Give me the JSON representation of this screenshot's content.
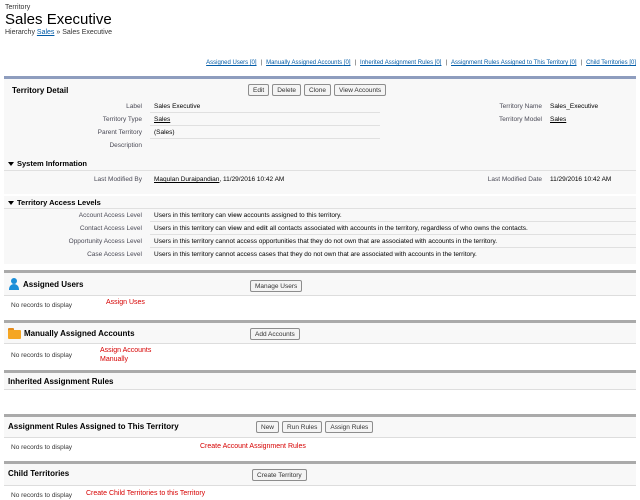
{
  "header": {
    "object_label": "Territory",
    "title": "Sales Executive",
    "hierarchy_label": "Hierarchy",
    "hierarchy_parent": "Sales",
    "hierarchy_sep": "»",
    "hierarchy_current": "Sales Executive"
  },
  "top_links": [
    {
      "label": "Assigned Users",
      "count": "[0]"
    },
    {
      "label": "Manually Assigned Accounts",
      "count": "[0]"
    },
    {
      "label": "Inherited Assignment Rules",
      "count": "[0]"
    },
    {
      "label": "Assignment Rules Assigned to This Territory",
      "count": "[0]"
    },
    {
      "label": "Child Territories",
      "count": "[0]"
    }
  ],
  "detail": {
    "title": "Territory Detail",
    "buttons": [
      "Edit",
      "Delete",
      "Clone",
      "View Accounts"
    ],
    "label_k": "Label",
    "label_v": "Sales Executive",
    "type_k": "Territory Type",
    "type_v": "Sales",
    "parent_k": "Parent Territory",
    "parent_v": "(Sales)",
    "desc_k": "Description",
    "desc_v": "",
    "name_k": "Territory Name",
    "name_v": "Sales_Executive",
    "model_k": "Territory Model",
    "model_v": "Sales"
  },
  "system_info": {
    "title": "System Information",
    "modified_by_k": "Last Modified By",
    "modified_by_user": "Maqulan Duraipandian",
    "modified_by_time": ", 11/29/2016 10:42 AM",
    "modified_date_k": "Last Modified Date",
    "modified_date_v": "11/29/2016 10:42 AM"
  },
  "access": {
    "title": "Territory Access Levels",
    "account_k": "Account Access Level",
    "account_v1": "Users in this territory can ",
    "account_bold": "view",
    "account_v2": " accounts assigned to this territory.",
    "contact_k": "Contact Access Level",
    "contact_v1": "Users in this territory can ",
    "contact_bold1": "view",
    "contact_and": " and ",
    "contact_bold2": "edit",
    "contact_v2": " all contacts associated with accounts in the territory, regardless of who owns the contacts.",
    "opp_k": "Opportunity Access Level",
    "opp_v": "Users in this territory cannot access opportunities that they do not own that are associated with accounts in the territory.",
    "case_k": "Case Access Level",
    "case_v": "Users in this territory cannot access cases that they do not own that are associated with accounts in the territory."
  },
  "related": {
    "no_records": "No records to display",
    "assigned_users": {
      "title": "Assigned Users",
      "button": "Manage Users",
      "note": "Assign Uses"
    },
    "manual_accounts": {
      "title": "Manually Assigned Accounts",
      "button": "Add Accounts",
      "note_l1": "Assign Accounts",
      "note_l2": "Manually"
    },
    "inherited_rules": {
      "title": "Inherited Assignment Rules"
    },
    "assigned_rules": {
      "title": "Assignment Rules Assigned to This Territory",
      "btn_new": "New",
      "btn_run": "Run Rules",
      "btn_assign": "Assign Rules",
      "note": "Create Account Assignment Rules"
    },
    "child_territories": {
      "title": "Child Territories",
      "button": "Create Territory",
      "note": "Create Child Territories to this Territory"
    }
  },
  "colors": {
    "link": "#015ba7",
    "annotation": "#d60000",
    "user_icon": "#1b8ed8",
    "folder_icon": "#f5a623"
  }
}
